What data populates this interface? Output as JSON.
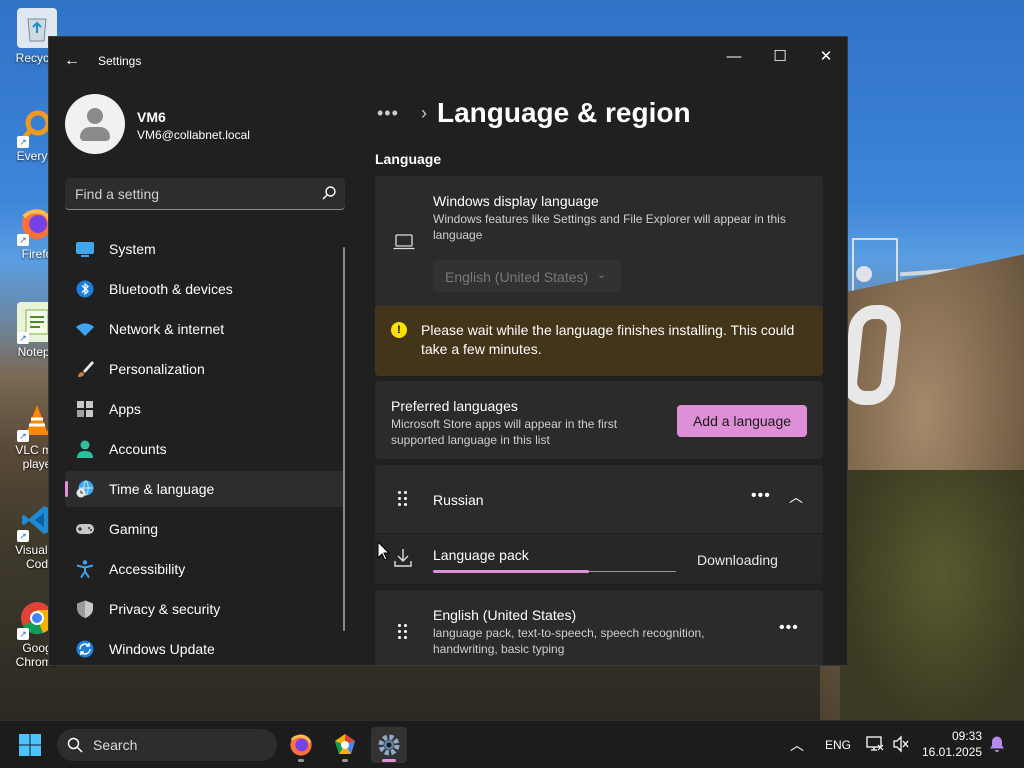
{
  "desktop": {
    "icons": [
      {
        "label": "Recycle",
        "name": "recycle-bin"
      },
      {
        "label": "Everyth",
        "name": "everything"
      },
      {
        "label": "Firefo",
        "name": "firefox"
      },
      {
        "label": "Notepa",
        "name": "notepad-plus-plus"
      },
      {
        "label": "VLC me\nplaye",
        "name": "vlc"
      },
      {
        "label": "Visual S\nCod",
        "name": "vscode"
      },
      {
        "label": "Goog\nChrome",
        "name": "chrome"
      }
    ]
  },
  "window": {
    "title": "Settings",
    "controls": {
      "minimize": "—",
      "maximize": "☐",
      "close": "✕"
    }
  },
  "profile": {
    "name": "VM6",
    "email": "VM6@collabnet.local"
  },
  "search": {
    "placeholder": "Find a setting"
  },
  "sidebar": {
    "items": [
      {
        "label": "System",
        "icon": "monitor-icon",
        "active": false
      },
      {
        "label": "Bluetooth & devices",
        "icon": "bluetooth-icon",
        "active": false
      },
      {
        "label": "Network & internet",
        "icon": "wifi-icon",
        "active": false
      },
      {
        "label": "Personalization",
        "icon": "brush-icon",
        "active": false
      },
      {
        "label": "Apps",
        "icon": "apps-icon",
        "active": false
      },
      {
        "label": "Accounts",
        "icon": "person-icon",
        "active": false
      },
      {
        "label": "Time & language",
        "icon": "globe-clock-icon",
        "active": true
      },
      {
        "label": "Gaming",
        "icon": "gamepad-icon",
        "active": false
      },
      {
        "label": "Accessibility",
        "icon": "accessibility-icon",
        "active": false
      },
      {
        "label": "Privacy & security",
        "icon": "shield-icon",
        "active": false
      },
      {
        "label": "Windows Update",
        "icon": "update-icon",
        "active": false
      }
    ]
  },
  "breadcrumb": {
    "dots": "•••",
    "title": "Language & region"
  },
  "language_section": {
    "heading": "Language",
    "display_language": {
      "title": "Windows display language",
      "description": "Windows features like Settings and File Explorer will appear in this language",
      "selected": "English (United States)"
    },
    "warning": "Please wait while the language finishes installing. This could take a few minutes.",
    "preferred": {
      "title": "Preferred languages",
      "description": "Microsoft Store apps will appear in the first supported language in this list",
      "button": "Add a language"
    },
    "languages": [
      {
        "name": "Russian",
        "more": "•••",
        "pack_label": "Language pack",
        "pack_status": "Downloading",
        "pack_progress": 0.64
      },
      {
        "name": "English (United States)",
        "features": "language pack, text-to-speech, speech recognition, handwriting, basic typing",
        "more": "•••"
      }
    ]
  },
  "taskbar": {
    "search_label": "Search",
    "language": "ENG",
    "time": "09:33",
    "date": "16.01.2025"
  },
  "colors": {
    "accent": "#df8fd7",
    "window_bg": "#202020",
    "card_bg": "#2b2b2b",
    "warning_bg": "#433519",
    "warning_icon": "#fce100"
  }
}
